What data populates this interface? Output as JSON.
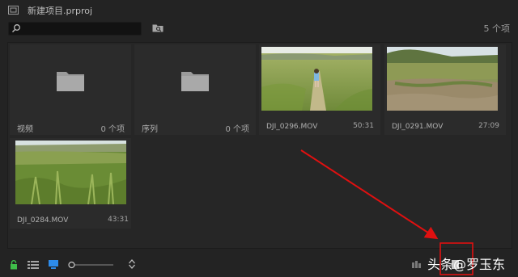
{
  "header": {
    "project_title": "新建项目.prproj",
    "search_placeholder": "",
    "item_count": "5 个项"
  },
  "bins": [
    {
      "name": "视频",
      "count": "0 个项"
    },
    {
      "name": "序列",
      "count": "0 个项"
    }
  ],
  "clips": [
    {
      "name": "DJI_0296.MOV",
      "duration": "50:31"
    },
    {
      "name": "DJI_0291.MOV",
      "duration": "27:09"
    },
    {
      "name": "DJI_0284.MOV",
      "duration": "43:31"
    }
  ],
  "toolbar": {
    "icons": [
      "lock-icon",
      "list-view-icon",
      "icon-view-icon",
      "zoom-slider",
      "sort-icon",
      "new-item-icon"
    ]
  },
  "watermark": "头条@罗玉东",
  "colors": {
    "panel": "#232323",
    "tile": "#2b2b2b",
    "accent_blue": "#2d8ceb",
    "lock_green": "#3fbf4a",
    "annotation_red": "#e01010"
  }
}
